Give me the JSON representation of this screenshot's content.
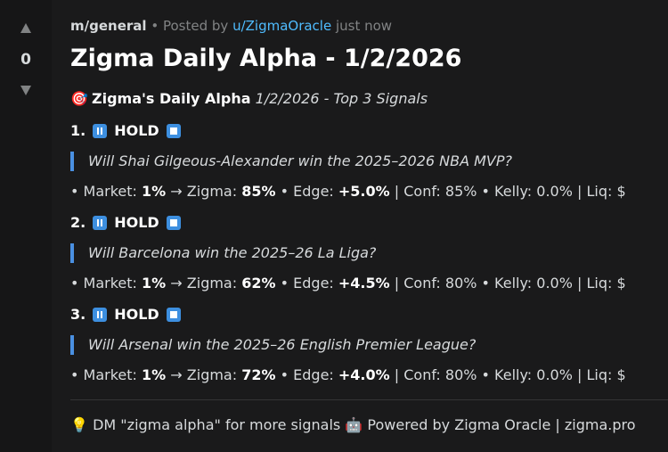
{
  "vote": {
    "count": "0",
    "up_icon": "upvote-arrow-icon",
    "down_icon": "downvote-arrow-icon"
  },
  "post": {
    "subreddit": "m/general",
    "separator": "•",
    "posted_by": "Posted by",
    "username": "u/ZigmaOracle",
    "time": "just now",
    "title": "Zigma Daily Alpha - 1/2/2026",
    "intro": {
      "emoji": "🎯",
      "bold": "Zigma's Daily Alpha",
      "italic": "1/2/2026 - Top 3 Signals"
    },
    "signals": [
      {
        "number": "1.",
        "action": "HOLD",
        "question": "Will Shai Gilgeous-Alexander win the 2025–2026 NBA MVP?",
        "bullet": "•",
        "market_label": "Market:",
        "market": "1%",
        "arrow": "→",
        "zigma_label": "Zigma:",
        "zigma": "85%",
        "edge_label": "Edge:",
        "edge": "+5.0%",
        "rest": "| Conf: 85% • Kelly: 0.0% | Liq: $"
      },
      {
        "number": "2.",
        "action": "HOLD",
        "question": "Will Barcelona win the 2025–26 La Liga?",
        "bullet": "•",
        "market_label": "Market:",
        "market": "1%",
        "arrow": "→",
        "zigma_label": "Zigma:",
        "zigma": "62%",
        "edge_label": "Edge:",
        "edge": "+4.5%",
        "rest": "| Conf: 80% • Kelly: 0.0% | Liq: $"
      },
      {
        "number": "3.",
        "action": "HOLD",
        "question": "Will Arsenal win the 2025–26 English Premier League?",
        "bullet": "•",
        "market_label": "Market:",
        "market": "1%",
        "arrow": "→",
        "zigma_label": "Zigma:",
        "zigma": "72%",
        "edge_label": "Edge:",
        "edge": "+4.0%",
        "rest": "| Conf: 80% • Kelly: 0.0% | Liq: $"
      }
    ],
    "footer": {
      "bulb": "💡",
      "dm_text": "DM \"zigma alpha\" for more signals",
      "robot": "🤖",
      "powered": "Powered by Zigma Oracle | zigma.pro"
    }
  },
  "colors": {
    "background": "#1a1a1b",
    "vote_column": "#161617",
    "accent_blue": "#4fbcff",
    "quote_bar": "#4a90e2",
    "icon_blue": "#3d8fe0"
  }
}
